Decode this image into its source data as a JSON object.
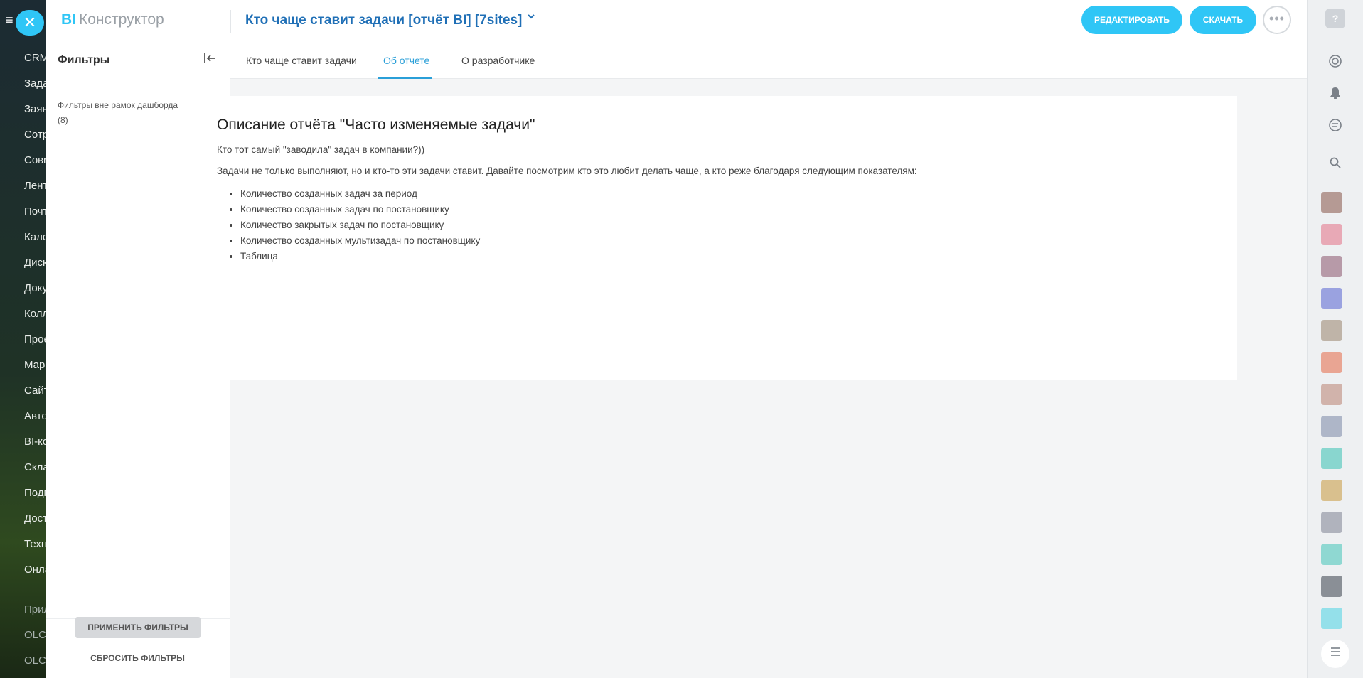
{
  "background_nav": {
    "items": [
      "CRM",
      "Задачи",
      "Заявки",
      "Сотрудники",
      "Совместная",
      "Лента",
      "Почта",
      "Календарь",
      "Диск",
      "Документы",
      "Коллаборации",
      "Проекты",
      "Маркетинг",
      "Сайты",
      "Автоматизация",
      "BI-конструктор",
      "Склад",
      "Подписка",
      "Доступы",
      "Техподдержка",
      "Онлайн"
    ],
    "bottom_items": [
      "Приложения",
      "OLCRM",
      "OLCRM"
    ]
  },
  "header": {
    "logo_bi": "BI",
    "logo_rest": "Конструктор",
    "report_title": "Кто чаще ставит задачи [отчёт BI] [7sites]",
    "edit_button": "РЕДАКТИРОВАТЬ",
    "download_button": "СКАЧАТЬ",
    "more_button": "•••"
  },
  "filters": {
    "title": "Фильтры",
    "group_label": "Фильтры вне рамок дашборда",
    "group_count": "(8)",
    "apply_button": "ПРИМЕНИТЬ ФИЛЬТРЫ",
    "reset_button": "СБРОСИТЬ ФИЛЬТРЫ"
  },
  "tabs": [
    {
      "label": "Кто чаще ставит задачи",
      "active": false
    },
    {
      "label": "Об отчете",
      "active": true
    },
    {
      "label": "О разработчике",
      "active": false
    }
  ],
  "content": {
    "heading": "Описание отчёта \"Часто изменяемые задачи\"",
    "intro": "Кто тот самый \"заводила\" задач в компании?))",
    "description": "Задачи не только выполняют, но и кто-то эти задачи ставит. Давайте посмотрим кто это любит делать чаще, а кто реже благодаря следующим показателям:",
    "items": [
      "Количество созданных задач за период",
      "Количество созданных задач по постановщику",
      "Количество закрытых задач по постановщику",
      "Количество созданных мультизадач по постановщику",
      "Таблица"
    ]
  },
  "rightbar": {
    "help": "?",
    "avatar_colors": [
      "#b59a94",
      "#e8a9b6",
      "#b79aa8",
      "#9aa2e0",
      "#bfb4a8",
      "#e9a593",
      "#d1b3ab",
      "#aeb6c8",
      "#89d6cf",
      "#d9c08e",
      "#b0b3bd",
      "#8fd8d2",
      "#8a8f96",
      "#94e0ea"
    ]
  },
  "colors": {
    "accent": "#2fc6f6",
    "title_blue": "#1f6fb6",
    "tab_active": "#2a9fd8"
  }
}
